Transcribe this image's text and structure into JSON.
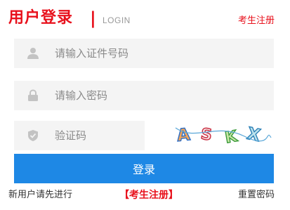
{
  "header": {
    "title": "用户登录",
    "separator": "|",
    "subtitle": "LOGIN",
    "register_link": "考生注册"
  },
  "form": {
    "id_placeholder": "请输入证件号码",
    "password_placeholder": "请输入密码",
    "captcha_placeholder": "验证码",
    "captcha_text": "ASKX",
    "submit_label": "登录"
  },
  "footer": {
    "hint": "新用户请先进行",
    "register_link": "【考生注册】",
    "reset_link": "重置密码"
  },
  "icons": {
    "user": "user-icon",
    "lock": "lock-icon",
    "shield": "shield-icon"
  },
  "colors": {
    "brand_red": "#e8111c",
    "button_blue": "#1e88e5",
    "field_bg": "#f4f4f4"
  }
}
